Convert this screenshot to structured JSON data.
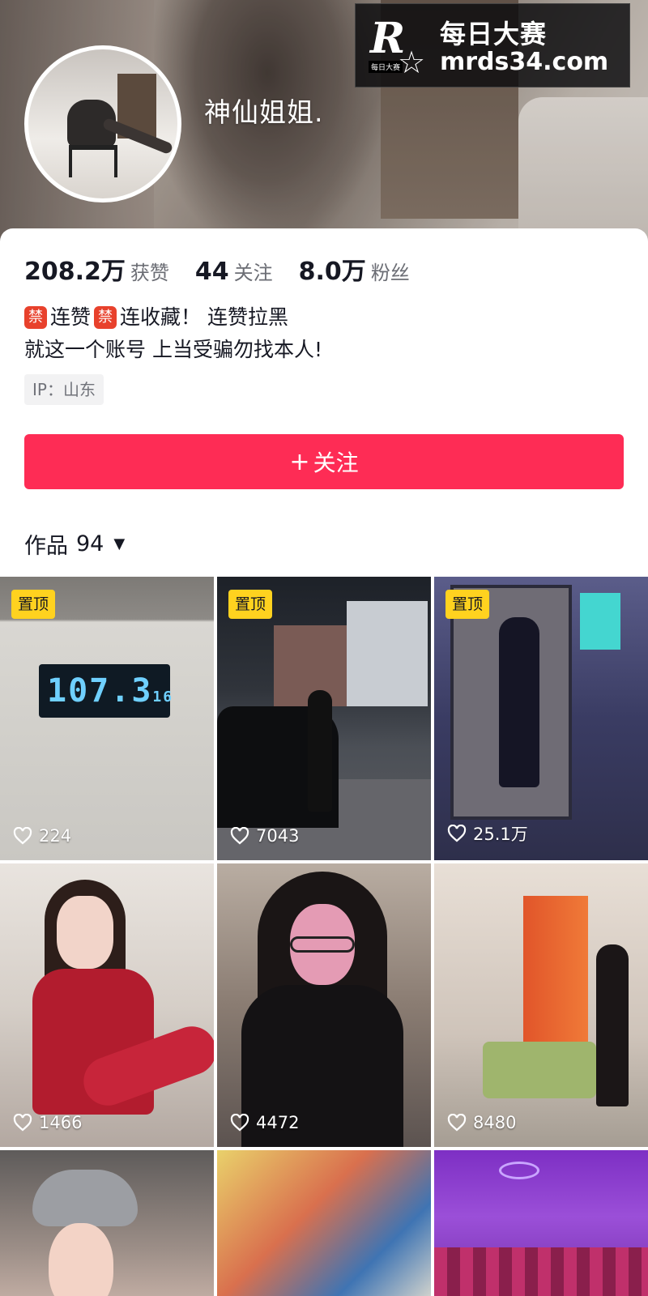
{
  "profile": {
    "nickname": "神仙姐姐.",
    "stats": [
      {
        "value": "208.2万",
        "label": "获赞"
      },
      {
        "value": "44",
        "label": "关注"
      },
      {
        "value": "8.0万",
        "label": "粉丝"
      }
    ],
    "bio": {
      "line1_badge": "禁",
      "line1_part1": "连赞",
      "line1_part2": "连收藏！ 连赞拉黑",
      "line2": "就这一个账号 上当受骗勿找本人!"
    },
    "ip_location": "IP：山东",
    "follow_button": {
      "plus": "+",
      "label": "关注"
    }
  },
  "watermark": {
    "logo_letter": "R",
    "logo_small": "每日大赛",
    "title": "每日大赛",
    "url": "mrds34.com"
  },
  "works": {
    "label": "作品",
    "count": "94",
    "caret": "▼"
  },
  "videos": [
    {
      "pinned_label": "置顶",
      "likes": "224",
      "overlay_text": "107.3",
      "overlay_unit": "16"
    },
    {
      "pinned_label": "置顶",
      "likes": "7043"
    },
    {
      "pinned_label": "置顶",
      "likes": "25.1万"
    },
    {
      "likes": "1466"
    },
    {
      "likes": "4472"
    },
    {
      "likes": "8480"
    }
  ],
  "colors": {
    "follow_button": "#fe2c55",
    "pinned_badge": "#ffd21f",
    "ban_badge": "#e8412c"
  },
  "icons": {
    "like": "heart-outline-icon",
    "dropdown": "caret-down-icon"
  }
}
